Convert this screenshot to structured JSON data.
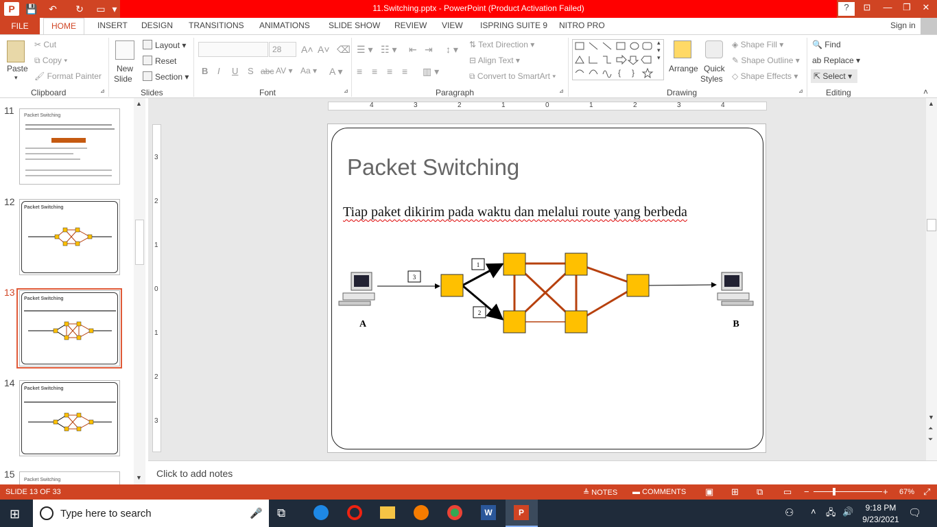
{
  "window": {
    "title": "11.Switching.pptx -  PowerPoint (Product Activation Failed)",
    "help": "?",
    "signin": "Sign in"
  },
  "tabs": {
    "file": "FILE",
    "items": [
      "HOME",
      "INSERT",
      "DESIGN",
      "TRANSITIONS",
      "ANIMATIONS",
      "SLIDE SHOW",
      "REVIEW",
      "VIEW",
      "ISPRING SUITE 9",
      "NITRO PRO"
    ]
  },
  "ribbon": {
    "clipboard": {
      "paste": "Paste",
      "cut": "Cut",
      "copy": "Copy",
      "format_painter": "Format Painter",
      "label": "Clipboard"
    },
    "slides": {
      "new_slide_1": "New",
      "new_slide_2": "Slide",
      "layout": "Layout",
      "reset": "Reset",
      "section": "Section",
      "label": "Slides"
    },
    "font": {
      "font_size": "28",
      "label": "Font"
    },
    "paragraph": {
      "text_direction": "Text Direction",
      "align_text": "Align Text",
      "convert_smartart": "Convert to SmartArt",
      "label": "Paragraph"
    },
    "drawing": {
      "arrange": "Arrange",
      "quick_styles_1": "Quick",
      "quick_styles_2": "Styles",
      "shape_fill": "Shape Fill",
      "shape_outline": "Shape Outline",
      "shape_effects": "Shape Effects",
      "label": "Drawing"
    },
    "editing": {
      "find": "Find",
      "replace": "Replace",
      "select": "Select",
      "label": "Editing"
    }
  },
  "thumbnails": [
    {
      "num": "11",
      "title": "Packet Switching"
    },
    {
      "num": "12",
      "title": "Packet Switching"
    },
    {
      "num": "13",
      "title": "Packet Switching"
    },
    {
      "num": "14",
      "title": "Packet Switching"
    },
    {
      "num": "15",
      "title": "Packet Switching"
    }
  ],
  "slide": {
    "title": "Packet Switching",
    "body": "Tiap paket dikirim pada waktu dan melalui route yang berbeda",
    "label_a": "A",
    "label_b": "B",
    "packets": [
      "1",
      "2",
      "3"
    ]
  },
  "ruler": {
    "h": [
      "4",
      "3",
      "2",
      "1",
      "0",
      "1",
      "2",
      "3",
      "4"
    ],
    "v": [
      "3",
      "2",
      "1",
      "0",
      "1",
      "2",
      "3"
    ]
  },
  "notes_placeholder": "Click to add notes",
  "status": {
    "slide": "SLIDE 13 OF 33",
    "notes": "NOTES",
    "comments": "COMMENTS",
    "zoom": "67%"
  },
  "taskbar": {
    "search_placeholder": "Type here to search",
    "time": "9:18 PM",
    "date": "9/23/2021"
  },
  "colors": {
    "accent": "#d04423",
    "node": "#ffc000",
    "link": "#b7410e"
  }
}
